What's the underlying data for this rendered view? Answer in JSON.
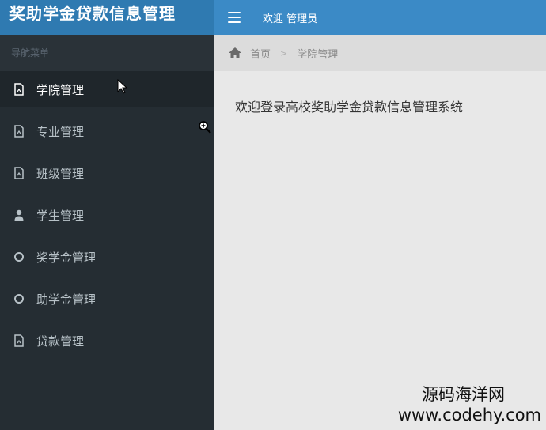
{
  "app": {
    "title": "奖助学金贷款信息管理"
  },
  "sidebar": {
    "header": "导航菜单",
    "items": [
      {
        "label": "学院管理",
        "icon": "document-icon",
        "active": true
      },
      {
        "label": "专业管理",
        "icon": "document-icon"
      },
      {
        "label": "班级管理",
        "icon": "document-icon"
      },
      {
        "label": "学生管理",
        "icon": "user-icon"
      },
      {
        "label": "奖学金管理",
        "icon": "circle-icon"
      },
      {
        "label": "助学金管理",
        "icon": "circle-icon"
      },
      {
        "label": "贷款管理",
        "icon": "document-icon"
      }
    ]
  },
  "topbar": {
    "welcome": "欢迎 管理员"
  },
  "breadcrumb": {
    "home": "首页",
    "separator": ">",
    "current": "学院管理"
  },
  "main": {
    "welcome_message": "欢迎登录高校奖助学金贷款信息管理系统"
  },
  "watermark": {
    "name": "源码海洋网",
    "url": "www.codehy.com"
  },
  "colors": {
    "brand": "#2f7ab1",
    "topbar": "#3b8ac6",
    "sidebar": "#252d33",
    "content": "#e8e8e8"
  }
}
